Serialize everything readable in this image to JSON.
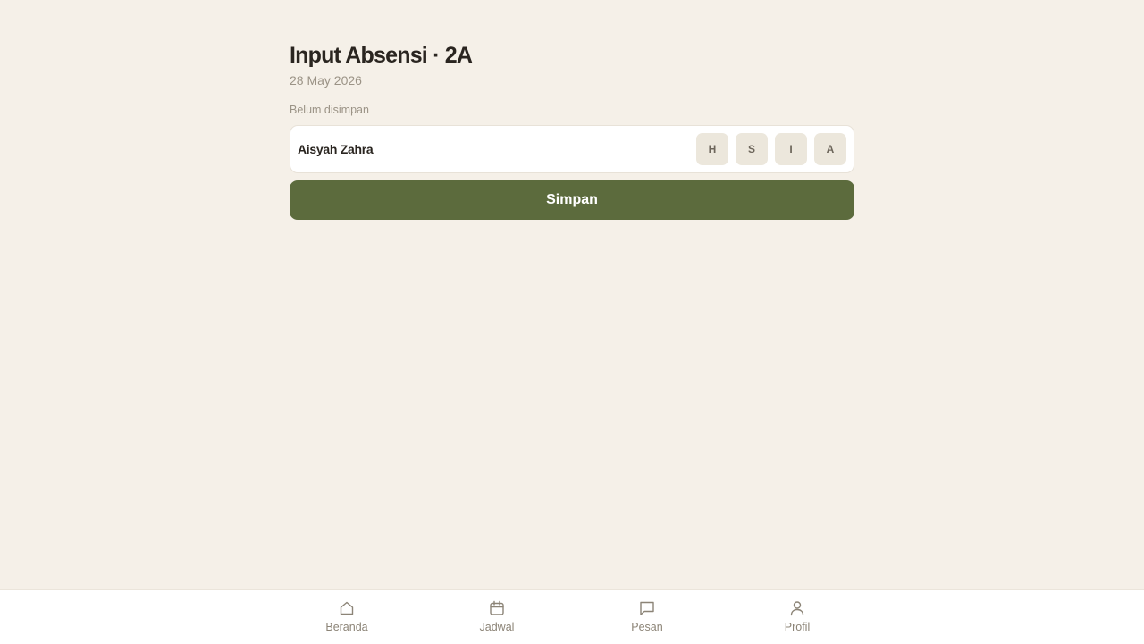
{
  "header": {
    "title": "Input Absensi · 2A",
    "date": "28 May 2026",
    "status": "Belum disimpan"
  },
  "students": [
    {
      "name": "Aisyah Zahra",
      "options": [
        "H",
        "S",
        "I",
        "A"
      ]
    }
  ],
  "actions": {
    "save_label": "Simpan"
  },
  "nav": {
    "items": [
      {
        "label": "Beranda",
        "icon": "home-icon"
      },
      {
        "label": "Jadwal",
        "icon": "calendar-icon"
      },
      {
        "label": "Pesan",
        "icon": "message-icon"
      },
      {
        "label": "Profil",
        "icon": "user-icon"
      }
    ]
  },
  "colors": {
    "background": "#f5f0e8",
    "accent": "#5c6b3d",
    "status_button_bg": "#ece7dc",
    "muted_text": "#9b9386"
  }
}
